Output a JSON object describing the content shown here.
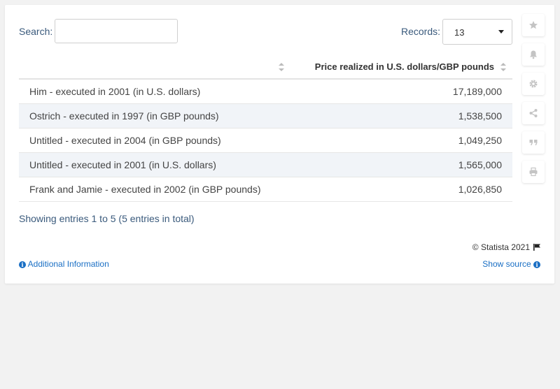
{
  "search": {
    "label": "Search:",
    "value": ""
  },
  "records": {
    "label": "Records:",
    "value": "13"
  },
  "table": {
    "headers": [
      "",
      "Price realized in U.S. dollars/GBP pounds"
    ],
    "rows": [
      {
        "name": "Him - executed in 2001 (in U.S. dollars)",
        "value": "17,189,000"
      },
      {
        "name": "Ostrich - executed in 1997 (in GBP pounds)",
        "value": "1,538,500"
      },
      {
        "name": "Untitled - executed in 2004 (in GBP pounds)",
        "value": "1,049,250"
      },
      {
        "name": "Untitled - executed in 2001 (in U.S. dollars)",
        "value": "1,565,000"
      },
      {
        "name": "Frank and Jamie - executed in 2002 (in GBP pounds)",
        "value": "1,026,850"
      }
    ]
  },
  "summary": "Showing entries 1 to 5 (5 entries in total)",
  "footer": {
    "copyright": "© Statista 2021",
    "additional_info": "Additional Information",
    "show_source": "Show source"
  },
  "toolbar_icons": [
    "star-icon",
    "bell-icon",
    "gear-icon",
    "share-icon",
    "quote-icon",
    "print-icon"
  ],
  "colors": {
    "accent": "#1a6fc4",
    "label": "#3a5a7c",
    "row_alt": "#f1f4f8"
  },
  "chart_data": {
    "type": "table",
    "columns": [
      "",
      "Price realized in U.S. dollars/GBP pounds"
    ],
    "categories": [
      "Him - executed in 2001 (in U.S. dollars)",
      "Ostrich - executed in 1997 (in GBP pounds)",
      "Untitled - executed in 2004 (in GBP pounds)",
      "Untitled - executed in 2001 (in U.S. dollars)",
      "Frank and Jamie - executed in 2002 (in GBP pounds)"
    ],
    "values": [
      17189000,
      1538500,
      1049250,
      1565000,
      1026850
    ]
  }
}
